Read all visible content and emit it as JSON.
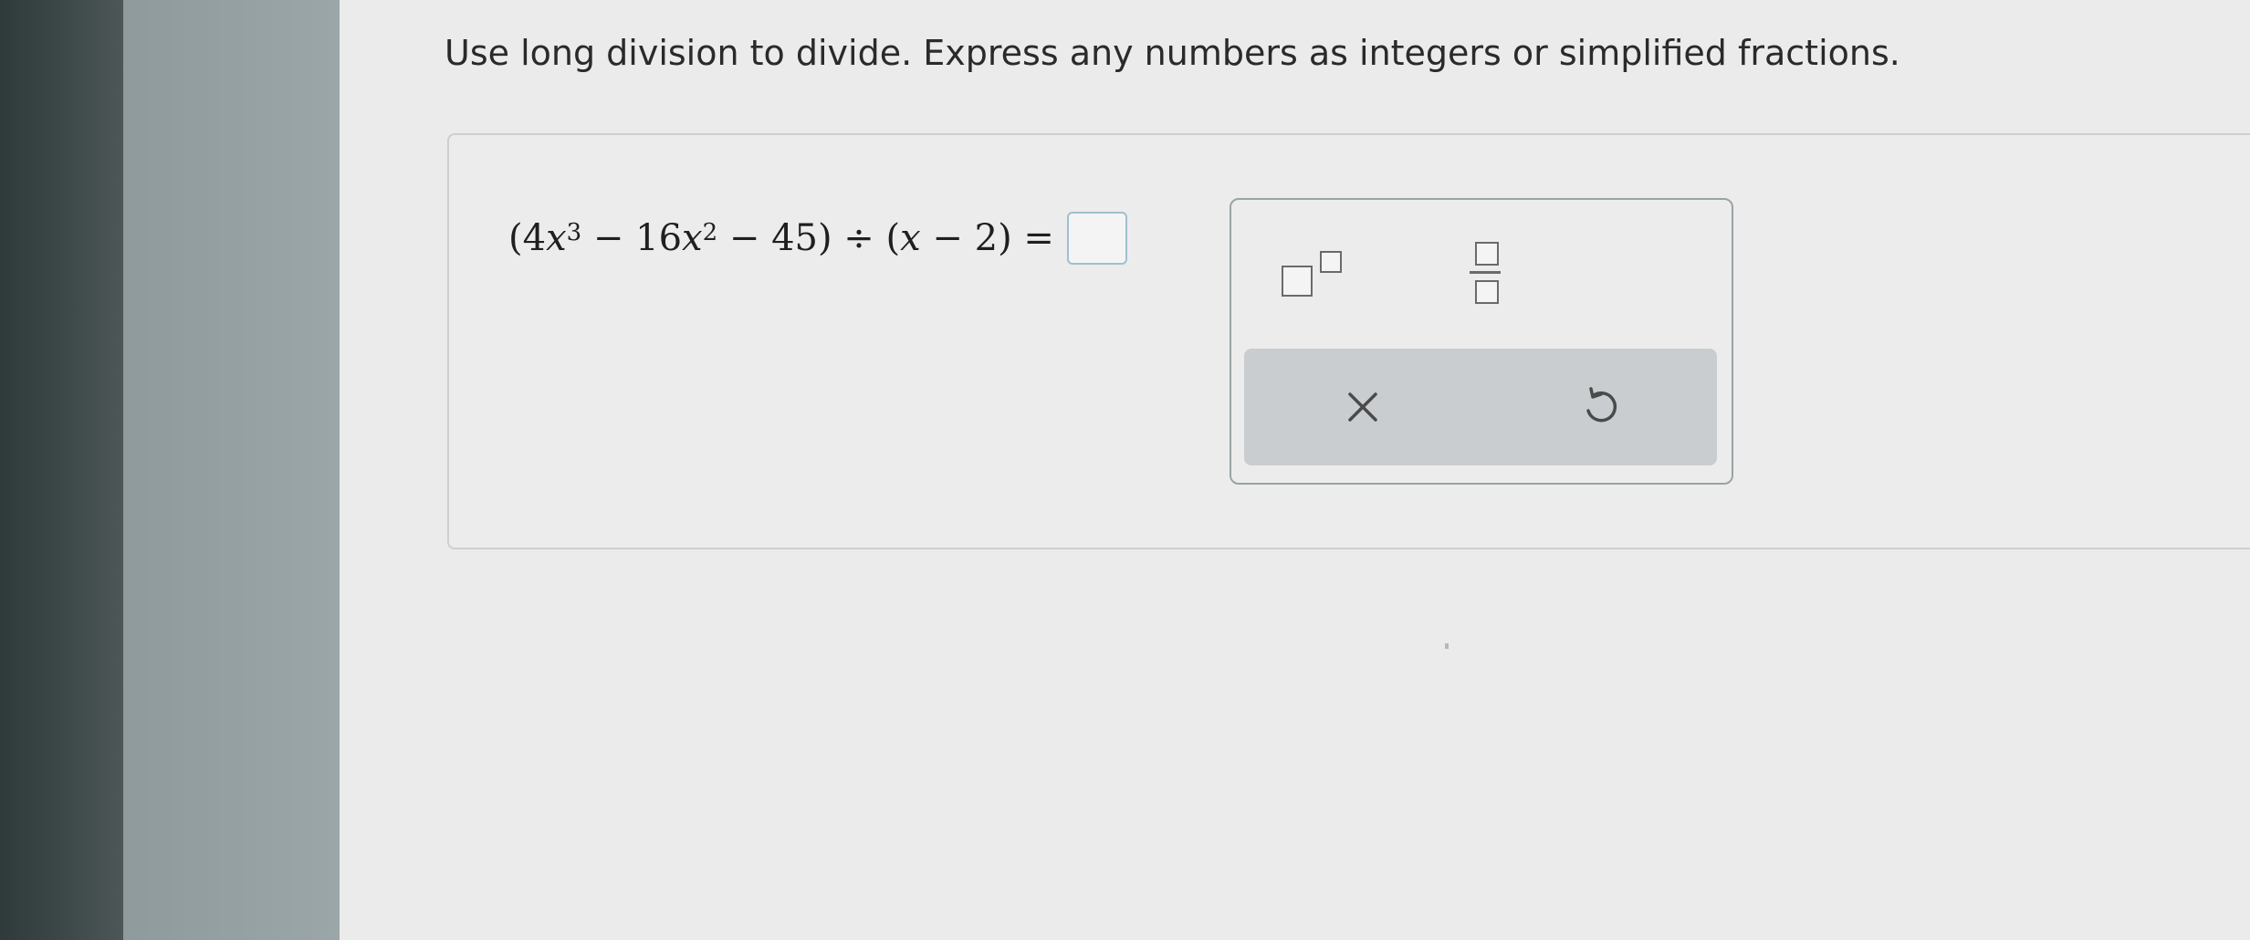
{
  "instructions": "Use long division to divide. Express any numbers as integers or simplified fractions.",
  "expression": {
    "open_paren": "(",
    "coef1": "4",
    "var1": "x",
    "exp1": "3",
    "minus1": " − 16",
    "var2": "x",
    "exp2": "2",
    "minus2": " − 45",
    "close_paren": ")",
    "divide": " ÷ ",
    "divisor_open": "(",
    "divisor_var": "x",
    "divisor_rest": " − 2",
    "divisor_close": ")",
    "equals": " ="
  },
  "answer": {
    "value": ""
  },
  "palette": {
    "buttons": [
      {
        "name": "superscript-button",
        "icon": "superscript-template-icon"
      },
      {
        "name": "fraction-button",
        "icon": "fraction-template-icon"
      },
      {
        "name": "clear-button",
        "icon": "close-icon"
      },
      {
        "name": "undo-button",
        "icon": "undo-icon"
      }
    ]
  },
  "colors": {
    "bezel": "#2f3a3b",
    "sidebar": "#98a3a5",
    "content_bg": "#ebebeb",
    "answer_border": "#9fc0cf",
    "action_bar": "#c9cdcf",
    "icon": "#4a4a4a"
  }
}
